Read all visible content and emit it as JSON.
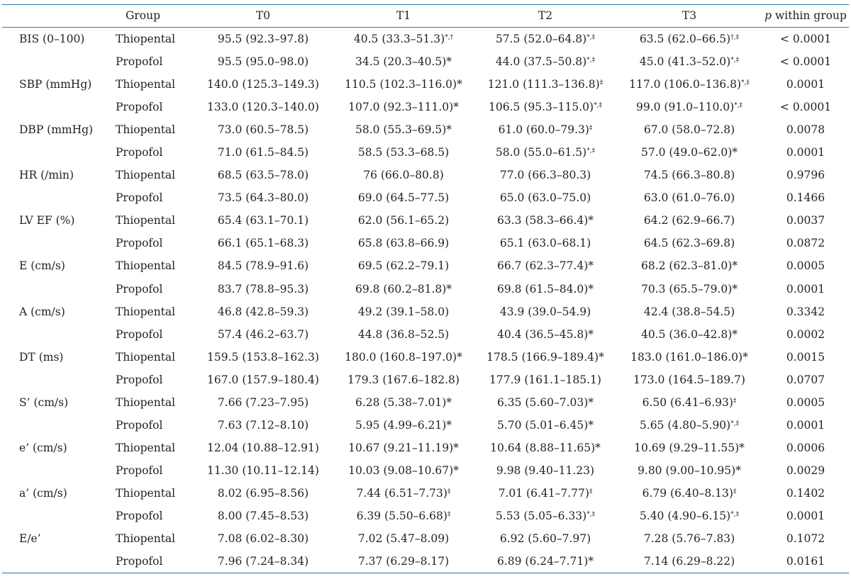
{
  "header": {
    "group": "Group",
    "t0": "T0",
    "t1": "T1",
    "t2": "T2",
    "t3": "T3",
    "p_letter": "p",
    "p_rest": " within group"
  },
  "rows": [
    {
      "param": "BIS (0–100)",
      "group": "Thiopental",
      "t0": "95.5 (92.3–97.8)",
      "t0m": "",
      "t1": "40.5 (33.3–51.3)",
      "t1m": "*,†",
      "t2": "57.5 (52.0–64.8)",
      "t2m": "*,‡",
      "t3": "63.5 (62.0–66.5)",
      "t3m": "†,‡",
      "p": "< 0.0001"
    },
    {
      "param": "",
      "group": "Propofol",
      "t0": "95.5 (95.0–98.0)",
      "t0m": "",
      "t1": "34.5 (20.3–40.5)*",
      "t1m": "",
      "t2": "44.0 (37.5–50.8)",
      "t2m": "*,‡",
      "t3": "45.0 (41.3–52.0)",
      "t3m": "*,‡",
      "p": "< 0.0001"
    },
    {
      "param": "SBP (mmHg)",
      "group": "Thiopental",
      "t0": "140.0 (125.3–149.3)",
      "t0m": "",
      "t1": "110.5 (102.3–116.0)*",
      "t1m": "",
      "t2": "121.0 (111.3–136.8)",
      "t2m": "‡",
      "t3": "117.0 (106.0–136.8)",
      "t3m": "*,‡",
      "p": "0.0001"
    },
    {
      "param": "",
      "group": "Propofol",
      "t0": "133.0 (120.3–140.0)",
      "t0m": "",
      "t1": "107.0 (92.3–111.0)*",
      "t1m": "",
      "t2": "106.5 (95.3–115.0)",
      "t2m": "*,‡",
      "t3": "99.0 (91.0–110.0)",
      "t3m": "*,‡",
      "p": "< 0.0001"
    },
    {
      "param": "DBP (mmHg)",
      "group": "Thiopental",
      "t0": "73.0 (60.5–78.5)",
      "t0m": "",
      "t1": "58.0 (55.3–69.5)*",
      "t1m": "",
      "t2": "61.0 (60.0–79.3)",
      "t2m": "‡",
      "t3": "67.0 (58.0–72.8)",
      "t3m": "",
      "p": "0.0078"
    },
    {
      "param": "",
      "group": "Propofol",
      "t0": "71.0 (61.5–84.5)",
      "t0m": "",
      "t1": "58.5 (53.3–68.5)",
      "t1m": "",
      "t2": "58.0 (55.0–61.5)",
      "t2m": "*,‡",
      "t3": "57.0 (49.0–62.0)*",
      "t3m": "",
      "p": "0.0001"
    },
    {
      "param": "HR (/min)",
      "group": "Thiopental",
      "t0": "68.5 (63.5–78.0)",
      "t0m": "",
      "t1": "76 (66.0–80.8)",
      "t1m": "",
      "t2": "77.0 (66.3–80.3)",
      "t2m": "",
      "t3": "74.5 (66.3–80.8)",
      "t3m": "",
      "p": "0.9796"
    },
    {
      "param": "",
      "group": "Propofol",
      "t0": "73.5 (64.3–80.0)",
      "t0m": "",
      "t1": "69.0 (64.5–77.5)",
      "t1m": "",
      "t2": "65.0 (63.0–75.0)",
      "t2m": "",
      "t3": "63.0 (61.0–76.0)",
      "t3m": "",
      "p": "0.1466"
    },
    {
      "param": "LV EF (%)",
      "group": "Thiopental",
      "t0": "65.4 (63.1–70.1)",
      "t0m": "",
      "t1": "62.0 (56.1–65.2)",
      "t1m": "",
      "t2": "63.3 (58.3–66.4)*",
      "t2m": "",
      "t3": "64.2 (62.9–66.7)",
      "t3m": "",
      "p": "0.0037"
    },
    {
      "param": "",
      "group": "Propofol",
      "t0": "66.1 (65.1–68.3)",
      "t0m": "",
      "t1": "65.8 (63.8–66.9)",
      "t1m": "",
      "t2": "65.1 (63.0–68.1)",
      "t2m": "",
      "t3": "64.5 (62.3–69.8)",
      "t3m": "",
      "p": "0.0872"
    },
    {
      "param": "E (cm/s)",
      "group": "Thiopental",
      "t0": "84.5 (78.9–91.6)",
      "t0m": "",
      "t1": "69.5 (62.2–79.1)",
      "t1m": "",
      "t2": "66.7 (62.3–77.4)*",
      "t2m": "",
      "t3": "68.2 (62.3–81.0)*",
      "t3m": "",
      "p": "0.0005"
    },
    {
      "param": "",
      "group": "Propofol",
      "t0": "83.7 (78.8–95.3)",
      "t0m": "",
      "t1": "69.8 (60.2–81.8)*",
      "t1m": "",
      "t2": "69.8 (61.5–84.0)*",
      "t2m": "",
      "t3": "70.3 (65.5–79.0)*",
      "t3m": "",
      "p": "0.0001"
    },
    {
      "param": "A (cm/s)",
      "group": "Thiopental",
      "t0": "46.8 (42.8–59.3)",
      "t0m": "",
      "t1": "49.2 (39.1–58.0)",
      "t1m": "",
      "t2": "43.9 (39.0–54.9)",
      "t2m": "",
      "t3": "42.4 (38.8–54.5)",
      "t3m": "",
      "p": "0.3342"
    },
    {
      "param": "",
      "group": "Propofol",
      "t0": "57.4 (46.2–63.7)",
      "t0m": "",
      "t1": "44.8 (36.8–52.5)",
      "t1m": "",
      "t2": "40.4 (36.5–45.8)*",
      "t2m": "",
      "t3": "40.5 (36.0–42.8)*",
      "t3m": "",
      "p": "0.0002"
    },
    {
      "param": "DT (ms)",
      "group": "Thiopental",
      "t0": "159.5 (153.8–162.3)",
      "t0m": "",
      "t1": "180.0 (160.8–197.0)*",
      "t1m": "",
      "t2": "178.5 (166.9–189.4)*",
      "t2m": "",
      "t3": "183.0 (161.0–186.0)*",
      "t3m": "",
      "p": "0.0015"
    },
    {
      "param": "",
      "group": "Propofol",
      "t0": "167.0 (157.9–180.4)",
      "t0m": "",
      "t1": "179.3 (167.6–182.8)",
      "t1m": "",
      "t2": "177.9 (161.1–185.1)",
      "t2m": "",
      "t3": "173.0 (164.5–189.7)",
      "t3m": "",
      "p": "0.0707"
    },
    {
      "param": "S’ (cm/s)",
      "group": "Thiopental",
      "t0": "7.66 (7.23–7.95)",
      "t0m": "",
      "t1": "6.28 (5.38–7.01)*",
      "t1m": "",
      "t2": "6.35 (5.60–7.03)*",
      "t2m": "",
      "t3": "6.50 (6.41–6.93)",
      "t3m": "‡",
      "p": "0.0005"
    },
    {
      "param": "",
      "group": "Propofol",
      "t0": "7.63 (7.12–8.10)",
      "t0m": "",
      "t1": "5.95 (4.99–6.21)*",
      "t1m": "",
      "t2": "5.70 (5.01–6.45)*",
      "t2m": "",
      "t3": "5.65 (4.80–5.90)",
      "t3m": "*,‡",
      "p": "0.0001"
    },
    {
      "param": "e’ (cm/s)",
      "group": "Thiopental",
      "t0": "12.04 (10.88–12.91)",
      "t0m": "",
      "t1": "10.67 (9.21–11.19)*",
      "t1m": "",
      "t2": "10.64 (8.88–11.65)*",
      "t2m": "",
      "t3": "10.69 (9.29–11.55)*",
      "t3m": "",
      "p": "0.0006"
    },
    {
      "param": "",
      "group": "Propofol",
      "t0": "11.30 (10.11–12.14)",
      "t0m": "",
      "t1": "10.03 (9.08–10.67)*",
      "t1m": "",
      "t2": "9.98 (9.40–11.23)",
      "t2m": "",
      "t3": "9.80 (9.00–10.95)*",
      "t3m": "",
      "p": "0.0029"
    },
    {
      "param": "a’ (cm/s)",
      "group": "Thiopental",
      "t0": "8.02 (6.95–8.56)",
      "t0m": "",
      "t1": "7.44 (6.51–7.73)",
      "t1m": "‡",
      "t2": "7.01 (6.41–7.77)",
      "t2m": "‡",
      "t3": "6.79 (6.40–8.13)",
      "t3m": "‡",
      "p": "0.1402"
    },
    {
      "param": "",
      "group": "Propofol",
      "t0": "8.00 (7.45–8.53)",
      "t0m": "",
      "t1": "6.39 (5.50–6.68)",
      "t1m": "‡",
      "t2": "5.53 (5.05–6.33)",
      "t2m": "*,‡",
      "t3": "5.40 (4.90–6.15)",
      "t3m": "*,‡",
      "p": "0.0001"
    },
    {
      "param": "E/e’",
      "group": "Thiopental",
      "t0": "7.08 (6.02–8.30)",
      "t0m": "",
      "t1": "7.02 (5.47–8.09)",
      "t1m": "",
      "t2": "6.92 (5.60–7.97)",
      "t2m": "",
      "t3": "7.28 (5.76–7.83)",
      "t3m": "",
      "p": "0.1072"
    },
    {
      "param": "",
      "group": "Propofol",
      "t0": "7.96 (7.24–8.34)",
      "t0m": "",
      "t1": "7.37 (6.29–8.17)",
      "t1m": "",
      "t2": "6.89 (6.24–7.71)*",
      "t2m": "",
      "t3": "7.14 (6.29–8.22)",
      "t3m": "",
      "p": "0.0161"
    }
  ],
  "colors": {
    "rule": "#2a78a8",
    "text": "#231f20",
    "background": "#ffffff"
  }
}
